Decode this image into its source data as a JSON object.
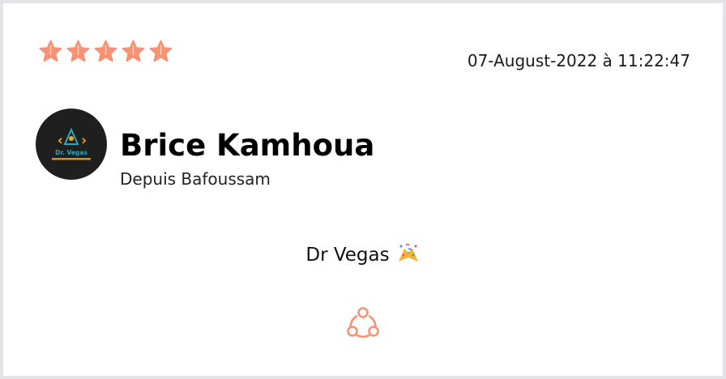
{
  "review": {
    "rating": 5,
    "rating_max": 5,
    "date": "07-August-2022 à 11:22:47",
    "author": {
      "name": "Brice Kamhoua",
      "location": "Depuis Bafoussam",
      "avatar_logo_text": "Dr. Vegas"
    },
    "message": "Dr Vegas",
    "message_emoji": "party-popper-icon"
  },
  "icons": {
    "star": "star-icon",
    "share": "share-icon"
  },
  "colors": {
    "accent": "#f79273",
    "avatar_bg": "#1f1f1f",
    "logo_orange": "#f5a623",
    "logo_teal": "#2aa7b8"
  }
}
